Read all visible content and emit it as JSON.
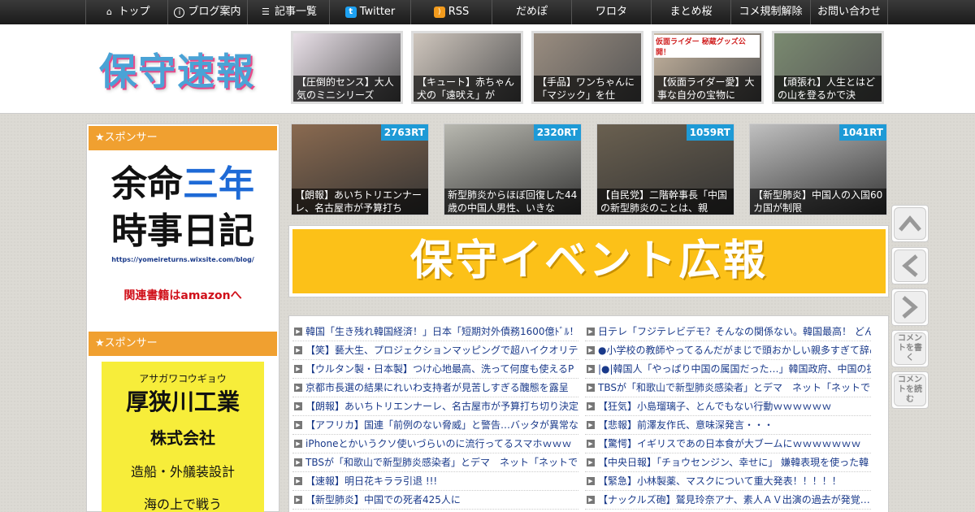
{
  "nav": {
    "items": [
      {
        "label": "トップ",
        "icon": "home-icon",
        "w": 101
      },
      {
        "label": "ブログ案内",
        "icon": "info-icon",
        "w": 98
      },
      {
        "label": "記事一覧",
        "icon": "list-icon",
        "w": 101
      },
      {
        "label": "Twitter",
        "icon": "twitter-icon",
        "w": 100
      },
      {
        "label": "RSS",
        "icon": "rss-icon",
        "w": 100
      },
      {
        "label": "だめぽ",
        "icon": "",
        "w": 98
      },
      {
        "label": "ワロタ",
        "icon": "",
        "w": 98
      },
      {
        "label": "まとめ桜",
        "icon": "",
        "w": 98
      },
      {
        "label": "コメ規制解除",
        "icon": "",
        "w": 98
      },
      {
        "label": "お問い合わせ",
        "icon": "",
        "w": 96
      }
    ]
  },
  "header": {
    "logo": "保守速報",
    "thumbs": [
      {
        "caption": "【圧倒的センス】大人気のミニシリーズ",
        "color": "#e9e0e8"
      },
      {
        "caption": "【キュート】赤ちゃん犬の「遠吠え」が",
        "color": "#cfc6bd"
      },
      {
        "caption": "【手品】ワンちゃんに「マジック」を仕",
        "color": "#9a8d80"
      },
      {
        "caption": "【仮面ライダー愛】大事な自分の宝物に",
        "color": "#c8b6a0"
      },
      {
        "caption": "【頑張れ】人生とはどの山を登るかで決",
        "color": "#7a8a70"
      }
    ],
    "thumb_overlay_text": "仮面ライダー 秘蔵グッズ公開！"
  },
  "sidebar": {
    "sponsor_label": "★スポンサー",
    "ad1": {
      "line1a": "余命",
      "line1b": "三年",
      "line2": "時事日記",
      "url": "https://yomeireturns.wixsite.com/blog/",
      "amazon": "関連書籍はamazonへ"
    },
    "ad2": {
      "kana": "アサガワコウギョウ",
      "name": "厚狭川工業",
      "corp": "株式会社",
      "desc": "造船・外艤装設計",
      "more": "海の上で戦う"
    }
  },
  "ranking": [
    {
      "count": "2763RT",
      "caption": "【朗報】あいちトリエンナーレ、名古屋市が予算打ち",
      "color": "#8a6a50"
    },
    {
      "count": "2320RT",
      "caption": "新型肺炎からほぼ回復した44歳の中国人男性、いきな",
      "color": "#b8b8b0"
    },
    {
      "count": "1059RT",
      "caption": "【自民党】二階幹事長「中国の新型肺炎のことは、親",
      "color": "#6a6050"
    },
    {
      "count": "1041RT",
      "caption": "【新型肺炎】中国人の入国60カ国が制限",
      "color": "#c0c0c0"
    }
  ],
  "banner": {
    "text": "保守イベント広報"
  },
  "links_left": [
    "韓国「生き残れ韓国経済！」日本「短期対外債務1600億ﾄﾞﾙ！為",
    "【笑】藝大生、プロジェクションマッピングで超ハイクオリテ",
    "【ウルタン製・日本製】つけ心地最高、洗って何度も使えるP",
    "京都市長選の結果にれいわ支持者が見苦しすぎる醜態を露呈",
    "【朗報】あいちトリエンナーレ、名古屋市が予算打ち切り決定",
    "【アフリカ】国連「前例のない脅威」と警告…バッタが異常な",
    "iPhoneとかいうクソ使いづらいのに流行ってるスマホｗｗｗ",
    "TBSが「和歌山で新型肺炎感染者」とデマ　ネット「ネットで",
    "【速報】明日花キララ引退 !!!",
    "【新型肺炎】中国での死者425人に"
  ],
  "links_right": [
    "日テレ「フジテレビデモ？そんなの関係ない。韓国最高！ どん",
    "●小学校の教師やってるんだがまじで頭おかしい親多すぎて辞め",
    "|●|韓国人「やっぱり中国の属国だった…」韓国政府、中国の抗",
    "TBSが「和歌山で新型肺炎感染者」とデマ　ネット「ネットで",
    "【狂気】小島瑠璃子、とんでもない行動ｗｗｗｗｗｗ",
    "【悲報】前澤友作氏、意味深発言・・・",
    "【驚愕】イギリスであの日本食が大ブームにｗｗｗｗｗｗｗ",
    "【中央日報】「チョウセンジン、幸せに」 嫌韓表現を使った韓",
    "【緊急】小林製薬、マスクについて重大発表！！！！！",
    "【ナックルズ砲】鷲見玲奈アナ、素人ＡＶ出演の過去が発覚…"
  ],
  "tools": {
    "comment_write": "コメントを書く",
    "comment_read": "コメントを読む"
  }
}
